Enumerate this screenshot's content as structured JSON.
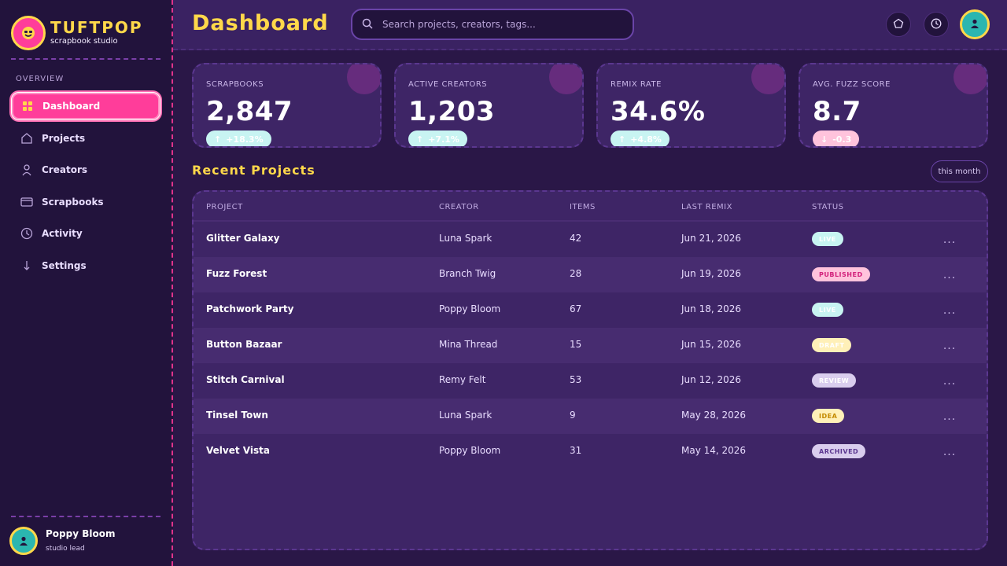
{
  "brand": {
    "name": "TUFTPOP",
    "subtitle": "scrapbook studio"
  },
  "sidebar": {
    "section_label": "OVERVIEW",
    "items": [
      {
        "label": "Dashboard",
        "icon": "grid-icon",
        "active": true
      },
      {
        "label": "Projects",
        "icon": "home-icon",
        "active": false
      },
      {
        "label": "Creators",
        "icon": "person-icon",
        "active": false
      },
      {
        "label": "Scrapbooks",
        "icon": "card-icon",
        "active": false
      },
      {
        "label": "Activity",
        "icon": "clock-icon",
        "active": false
      },
      {
        "label": "Settings",
        "icon": "arrow-down-icon",
        "active": false
      }
    ],
    "user": {
      "name": "Poppy Bloom",
      "role": "studio lead"
    }
  },
  "header": {
    "title": "Dashboard",
    "search_placeholder": "Search projects, creators, tags..."
  },
  "stats": [
    {
      "label": "SCRAPBOOKS",
      "value": "2,847",
      "change": "+18.3%",
      "direction": "up"
    },
    {
      "label": "ACTIVE CREATORS",
      "value": "1,203",
      "change": "+7.1%",
      "direction": "up"
    },
    {
      "label": "REMIX RATE",
      "value": "34.6%",
      "change": "+4.8%",
      "direction": "up"
    },
    {
      "label": "AVG. FUZZ SCORE",
      "value": "8.7",
      "change": "-0.3",
      "direction": "down"
    }
  ],
  "recent": {
    "title": "Recent Projects",
    "period": "this month",
    "columns": [
      "PROJECT",
      "CREATOR",
      "ITEMS",
      "LAST REMIX",
      "STATUS"
    ],
    "rows": [
      {
        "project": "Glitter Galaxy",
        "creator": "Luna Spark",
        "items": "42",
        "last_remix": "Jun 21, 2026",
        "status": "LIVE"
      },
      {
        "project": "Fuzz Forest",
        "creator": "Branch Twig",
        "items": "28",
        "last_remix": "Jun 19, 2026",
        "status": "PUBLISHED"
      },
      {
        "project": "Patchwork Party",
        "creator": "Poppy Bloom",
        "items": "67",
        "last_remix": "Jun 18, 2026",
        "status": "LIVE"
      },
      {
        "project": "Button Bazaar",
        "creator": "Mina Thread",
        "items": "15",
        "last_remix": "Jun 15, 2026",
        "status": "DRAFT"
      },
      {
        "project": "Stitch Carnival",
        "creator": "Remy Felt",
        "items": "53",
        "last_remix": "Jun 12, 2026",
        "status": "REVIEW"
      },
      {
        "project": "Tinsel Town",
        "creator": "Luna Spark",
        "items": "9",
        "last_remix": "May 28, 2026",
        "status": "IDEA"
      },
      {
        "project": "Velvet Vista",
        "creator": "Poppy Bloom",
        "items": "31",
        "last_remix": "May 14, 2026",
        "status": "ARCHIVED"
      }
    ],
    "more_label": "..."
  },
  "colors": {
    "accent_pink": "#ff3d9a",
    "accent_yellow": "#ffd84a",
    "teal": "#2bb6b0",
    "status": {
      "LIVE": {
        "bg": "#c8f4f2",
        "fg": "#ffffff"
      },
      "PUBLISHED": {
        "bg": "#ffc3dc",
        "fg": "#d21f7a"
      },
      "DRAFT": {
        "bg": "#fff0b8",
        "fg": "#ffffff"
      },
      "REVIEW": {
        "bg": "#d9cdee",
        "fg": "#ffffff"
      },
      "IDEA": {
        "bg": "#fff0b8",
        "fg": "#c48a00"
      },
      "ARCHIVED": {
        "bg": "#d9cdee",
        "fg": "#5b3790"
      }
    }
  }
}
